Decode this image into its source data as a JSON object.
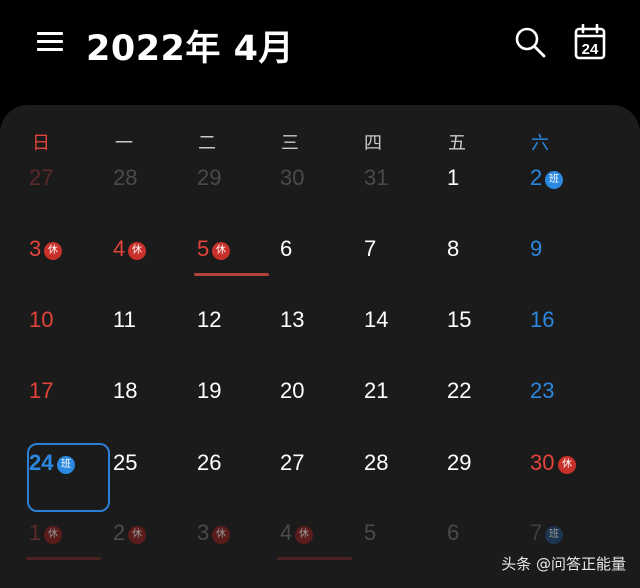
{
  "header": {
    "title": "2022年 4月",
    "today_icon_day": "24"
  },
  "icons": {
    "menu": "menu-icon",
    "search": "search-icon",
    "today": "calendar-today-icon"
  },
  "colors": {
    "normal": "#ffffff",
    "sunday": "#e2433a",
    "saturday": "#2b88e0",
    "dim": "#4a4a4a",
    "dim_sunday": "#5c2a28",
    "dim_saturday": "#3a3f47",
    "holiday_badge": "#c8302a",
    "work_badge": "#2b88e0",
    "selected_border": "#2b7fd8",
    "panel_bg": "#1b1b1b"
  },
  "weekdays": [
    "日",
    "一",
    "二",
    "三",
    "四",
    "五",
    "六"
  ],
  "selected_date": "24",
  "weeks": [
    [
      {
        "d": "27",
        "dim": true
      },
      {
        "d": "28",
        "dim": true
      },
      {
        "d": "29",
        "dim": true
      },
      {
        "d": "30",
        "dim": true
      },
      {
        "d": "31",
        "dim": true
      },
      {
        "d": "1"
      },
      {
        "d": "2",
        "badge": "班"
      }
    ],
    [
      {
        "d": "3",
        "badge": "休"
      },
      {
        "d": "4",
        "badge": "休"
      },
      {
        "d": "5",
        "badge": "休",
        "underline": true
      },
      {
        "d": "6"
      },
      {
        "d": "7"
      },
      {
        "d": "8"
      },
      {
        "d": "9"
      }
    ],
    [
      {
        "d": "10"
      },
      {
        "d": "11"
      },
      {
        "d": "12"
      },
      {
        "d": "13"
      },
      {
        "d": "14"
      },
      {
        "d": "15"
      },
      {
        "d": "16"
      }
    ],
    [
      {
        "d": "17"
      },
      {
        "d": "18"
      },
      {
        "d": "19"
      },
      {
        "d": "20"
      },
      {
        "d": "21"
      },
      {
        "d": "22"
      },
      {
        "d": "23"
      }
    ],
    [
      {
        "d": "24",
        "badge": "班",
        "selected": true
      },
      {
        "d": "25"
      },
      {
        "d": "26"
      },
      {
        "d": "27"
      },
      {
        "d": "28"
      },
      {
        "d": "29"
      },
      {
        "d": "30",
        "badge": "休"
      }
    ],
    [
      {
        "d": "1",
        "dim": true,
        "badge": "休",
        "underline": true
      },
      {
        "d": "2",
        "dim": true,
        "badge": "休"
      },
      {
        "d": "3",
        "dim": true,
        "badge": "休"
      },
      {
        "d": "4",
        "dim": true,
        "badge": "休",
        "underline": true
      },
      {
        "d": "5",
        "dim": true
      },
      {
        "d": "6",
        "dim": true
      },
      {
        "d": "7",
        "dim": true,
        "badge": "班"
      }
    ]
  ],
  "watermark": "头条 @问答正能量"
}
